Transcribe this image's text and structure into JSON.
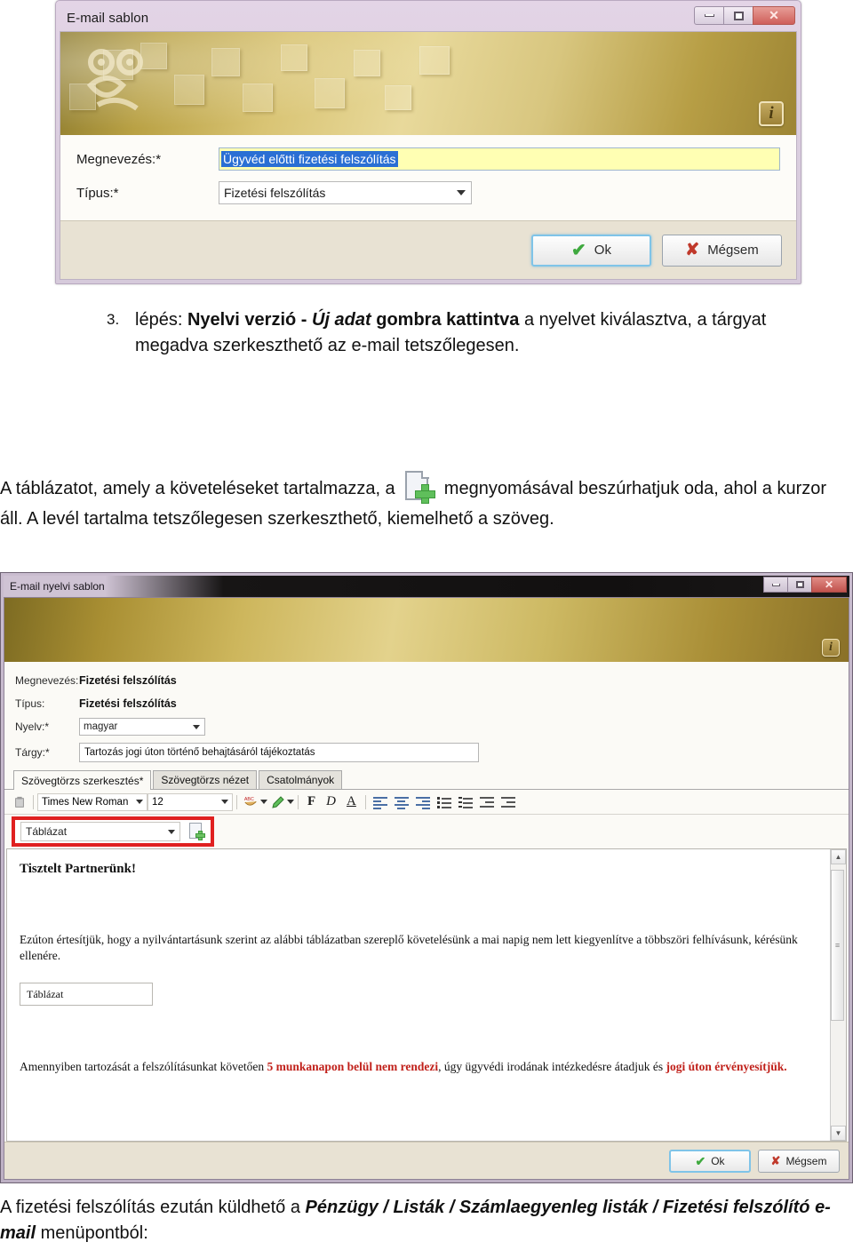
{
  "dialog1": {
    "title": "E-mail sablon",
    "window_buttons": {
      "minimize": "minimize-icon",
      "maximize": "maximize-icon",
      "close": "✕"
    },
    "info_badge": "i",
    "fields": [
      {
        "label": "Megnevezés:*",
        "value": "Ügyvéd előtti fizetési felszólítás",
        "type": "text-selected"
      },
      {
        "label": "Típus:*",
        "value": "Fizetési felszólítás",
        "type": "select"
      }
    ],
    "buttons": {
      "ok": "Ok",
      "cancel": "Mégsem"
    }
  },
  "step3": {
    "number": "3.",
    "prefix": "lépés: ",
    "bold1": "Nyelvi verzió - ",
    "bolditalic": "Új adat",
    "bold2": " gombra kattintva",
    "rest": " a nyelvet kiválasztva, a tárgyat megadva szerkeszthető az e-mail tetszőlegesen."
  },
  "para2": {
    "part1": "A táblázatot, amely a követeléseket tartalmazza, a ",
    "icon": "insert-table-icon",
    "part2": " megnyomásával beszúrhatjuk oda, ahol a kurzor áll. A levél tartalma tetszőlegesen szerkeszthető, kiemelhető a szöveg."
  },
  "dialog2": {
    "title": "E-mail nyelvi sablon",
    "window_buttons": {
      "minimize": "minimize-icon",
      "maximize": "maximize-icon",
      "close": "✕"
    },
    "fields": {
      "megnevezes": {
        "label": "Megnevezés:",
        "value": "Fizetési felszólítás"
      },
      "tipus": {
        "label": "Típus:",
        "value": "Fizetési felszólítás"
      },
      "nyelv": {
        "label": "Nyelv:*",
        "value": "magyar"
      },
      "targy": {
        "label": "Tárgy:*",
        "value": "Tartozás jogi úton történő behajtásáról tájékoztatás"
      }
    },
    "tabs": [
      {
        "label": "Szövegtörzs szerkesztés*",
        "active": true
      },
      {
        "label": "Szövegtörzs nézet",
        "active": false
      },
      {
        "label": "Csatolmányok",
        "active": false
      }
    ],
    "toolbar": {
      "font_name": "Times New Roman",
      "font_size": "12",
      "bold": "F",
      "italic": "D",
      "underline": "A",
      "spellcheck_icon": "abc-spellcheck-icon",
      "highlight_icon": "highlighter-pen-icon",
      "align_left_icon": "align-left-icon",
      "align_center_icon": "align-center-icon",
      "align_right_icon": "align-right-icon",
      "bullet_list_icon": "bullet-list-icon",
      "numbered_list_icon": "numbered-list-icon",
      "indent_decrease_icon": "indent-decrease-icon",
      "indent_increase_icon": "indent-increase-icon"
    },
    "table_bar": {
      "selected": "Táblázat",
      "insert_icon": "insert-table-icon"
    },
    "editor": {
      "greeting": "Tisztelt Partnerünk!",
      "paragraph1": "Ezúton értesítjük, hogy a nyilvántartásunk szerint az alábbi táblázatban szereplő követelésünk a mai napig nem lett kiegyenlítve a többszöri felhívásunk, kérésünk ellenére.",
      "table_placeholder": "Táblázat",
      "paragraph2_pre": "Amennyiben tartozását a felszólításunkat követően ",
      "paragraph2_red1": "5 munkanapon belül nem rendezi",
      "paragraph2_mid": ", úgy ügyvédi irodának intézkedésre átadjuk és ",
      "paragraph2_red2": "jogi úton érvényesítjük."
    },
    "buttons": {
      "ok": "Ok",
      "cancel": "Mégsem"
    }
  },
  "para3": {
    "part1": "A fizetési felszólítás ezután küldhető a ",
    "bold1": "Pénzügy / Listák / Számlaegyenleg listák / Fizetési felszólító e-mail",
    "part2": " menüpontból:"
  },
  "colors": {
    "accent_red": "#e02020",
    "editor_red_text": "#c0201a",
    "selection_blue": "#2a6fd4",
    "input_yellow": "#ffffb3",
    "banner_gold": "#cdb65c",
    "titlebar_lilac": "#dccfe0"
  }
}
